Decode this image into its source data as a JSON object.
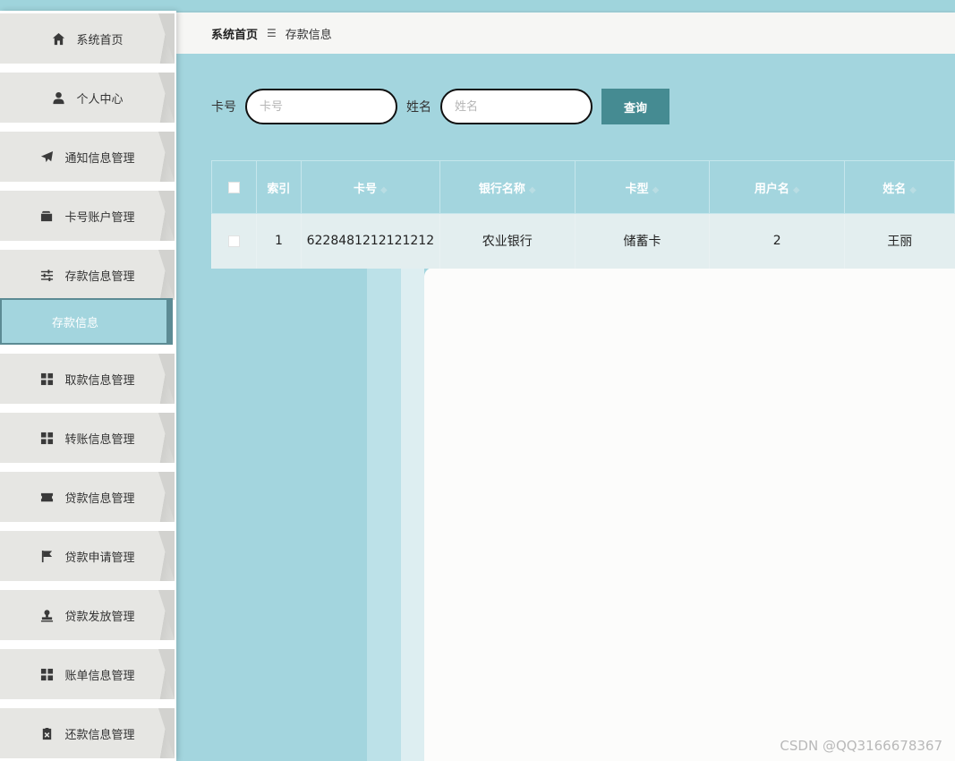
{
  "sidebar": {
    "items": [
      {
        "label": "系统首页",
        "icon": "home-icon"
      },
      {
        "label": "个人中心",
        "icon": "user-icon"
      },
      {
        "label": "通知信息管理",
        "icon": "send-icon"
      },
      {
        "label": "卡号账户管理",
        "icon": "wallet-icon"
      },
      {
        "label": "存款信息管理",
        "icon": "sliders-icon"
      },
      {
        "label": "取款信息管理",
        "icon": "grid-icon"
      },
      {
        "label": "转账信息管理",
        "icon": "grid-icon"
      },
      {
        "label": "贷款信息管理",
        "icon": "ticket-icon"
      },
      {
        "label": "贷款申请管理",
        "icon": "flag-icon"
      },
      {
        "label": "贷款发放管理",
        "icon": "stamp-icon"
      },
      {
        "label": "账单信息管理",
        "icon": "grid-icon"
      },
      {
        "label": "还款信息管理",
        "icon": "clipboard-icon"
      }
    ],
    "active_sub": "存款信息"
  },
  "breadcrumb": {
    "home": "系统首页",
    "separator": "☰",
    "current": "存款信息"
  },
  "search": {
    "card_label": "卡号",
    "card_placeholder": "卡号",
    "name_label": "姓名",
    "name_placeholder": "姓名",
    "button": "查询"
  },
  "table": {
    "columns": [
      "索引",
      "卡号",
      "银行名称",
      "卡型",
      "用户名",
      "姓名"
    ],
    "rows": [
      [
        "1",
        "6228481212121212",
        "农业银行",
        "储蓄卡",
        "2",
        "王丽"
      ]
    ]
  },
  "watermark": "CSDN @QQ3166678367",
  "colors": {
    "accent": "#a3d5de",
    "button": "#458b92",
    "menu_bg": "#e6e6e3"
  }
}
